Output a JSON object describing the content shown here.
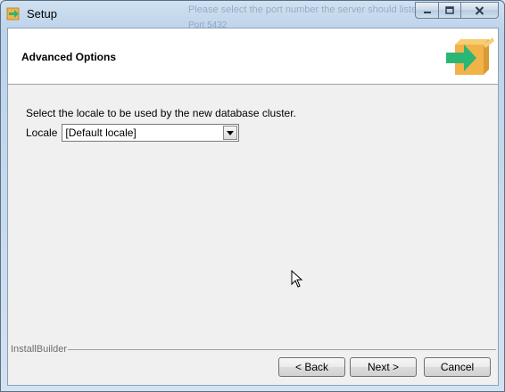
{
  "window": {
    "title": "Setup",
    "background_ghost_line1": "Please select the port number the server should listen on.",
    "background_ghost_line2": "Port  5432"
  },
  "header": {
    "title": "Advanced Options",
    "icon": "box-arrow-icon"
  },
  "main": {
    "prompt": "Select the locale to be used by the new database cluster.",
    "locale_label": "Locale",
    "locale_value": "[Default locale]"
  },
  "footer": {
    "brand": "InstallBuilder",
    "back_label": "< Back",
    "next_label": "Next >",
    "cancel_label": "Cancel"
  },
  "colors": {
    "accent_green": "#2bb673",
    "box_orange": "#f2b24a"
  }
}
